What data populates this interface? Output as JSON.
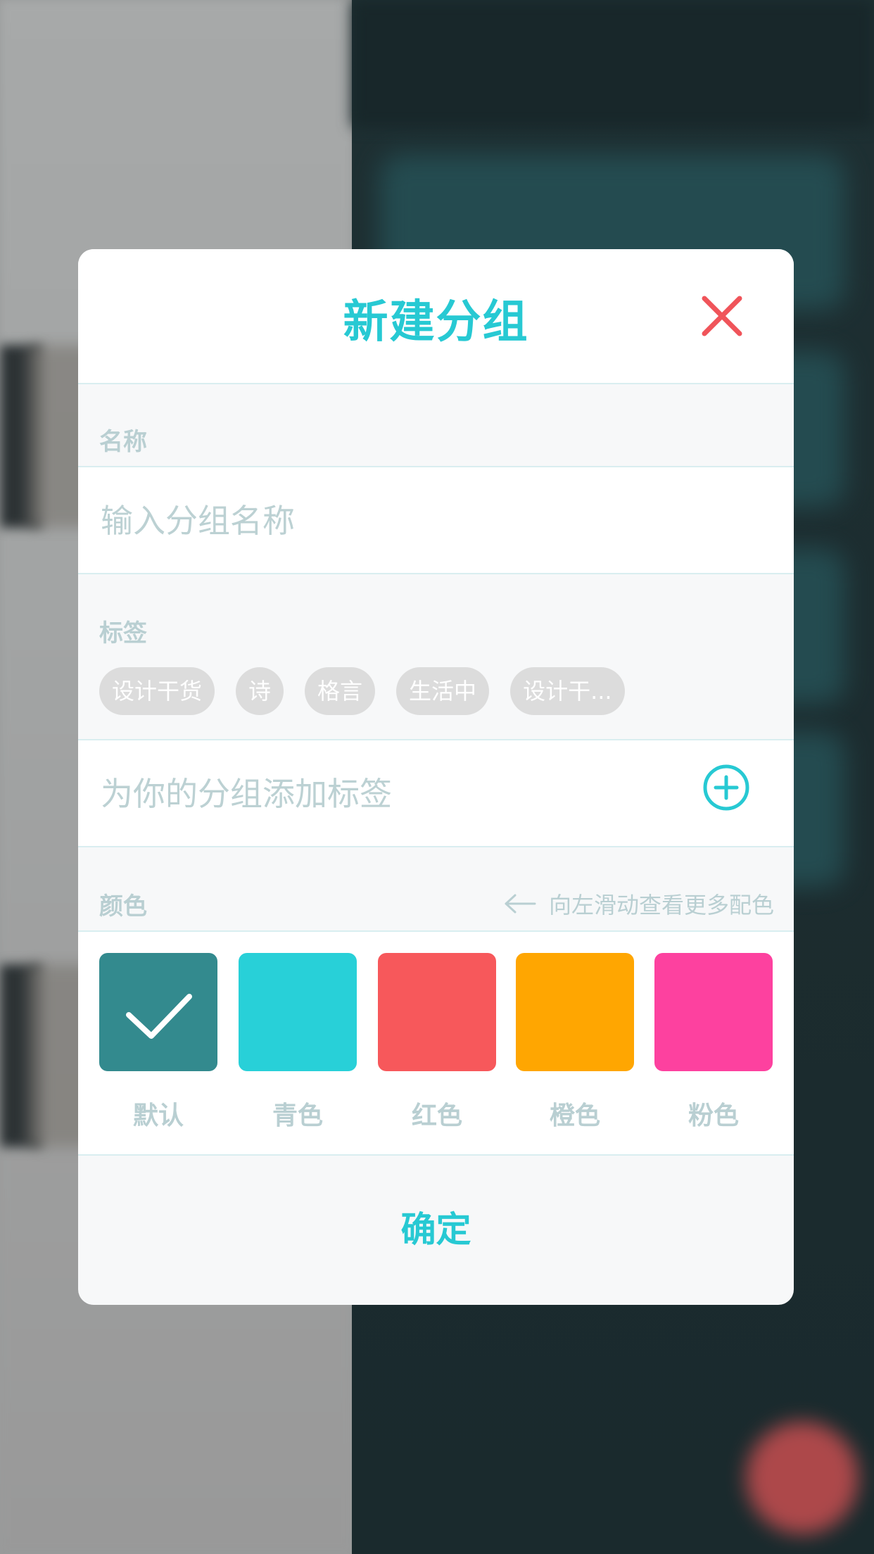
{
  "modal": {
    "title": "新建分组",
    "name_section": {
      "label": "名称",
      "placeholder": "输入分组名称"
    },
    "tags_section": {
      "label": "标签",
      "tags": [
        "设计干货",
        "诗",
        "格言",
        "生活中",
        "设计干..."
      ],
      "add_placeholder": "为你的分组添加标签"
    },
    "color_section": {
      "label": "颜色",
      "hint": "向左滑动查看更多配色",
      "selected": "默认",
      "options": [
        {
          "label": "默认",
          "color": "#338a8e",
          "selected": true
        },
        {
          "label": "青色",
          "color": "#28d0d8",
          "selected": false
        },
        {
          "label": "红色",
          "color": "#f7585b",
          "selected": false
        },
        {
          "label": "橙色",
          "color": "#ffa601",
          "selected": false
        },
        {
          "label": "粉色",
          "color": "#fd419f",
          "selected": false
        }
      ]
    },
    "confirm_label": "确定"
  },
  "icons": {
    "close": "close-icon",
    "add": "plus-circle-icon",
    "hint_arrow": "arrow-left-icon",
    "selected_check": "checkmark-icon"
  },
  "colors": {
    "accent": "#27c9d3",
    "close": "#f0545a",
    "muted_text": "#b9cfd2"
  }
}
